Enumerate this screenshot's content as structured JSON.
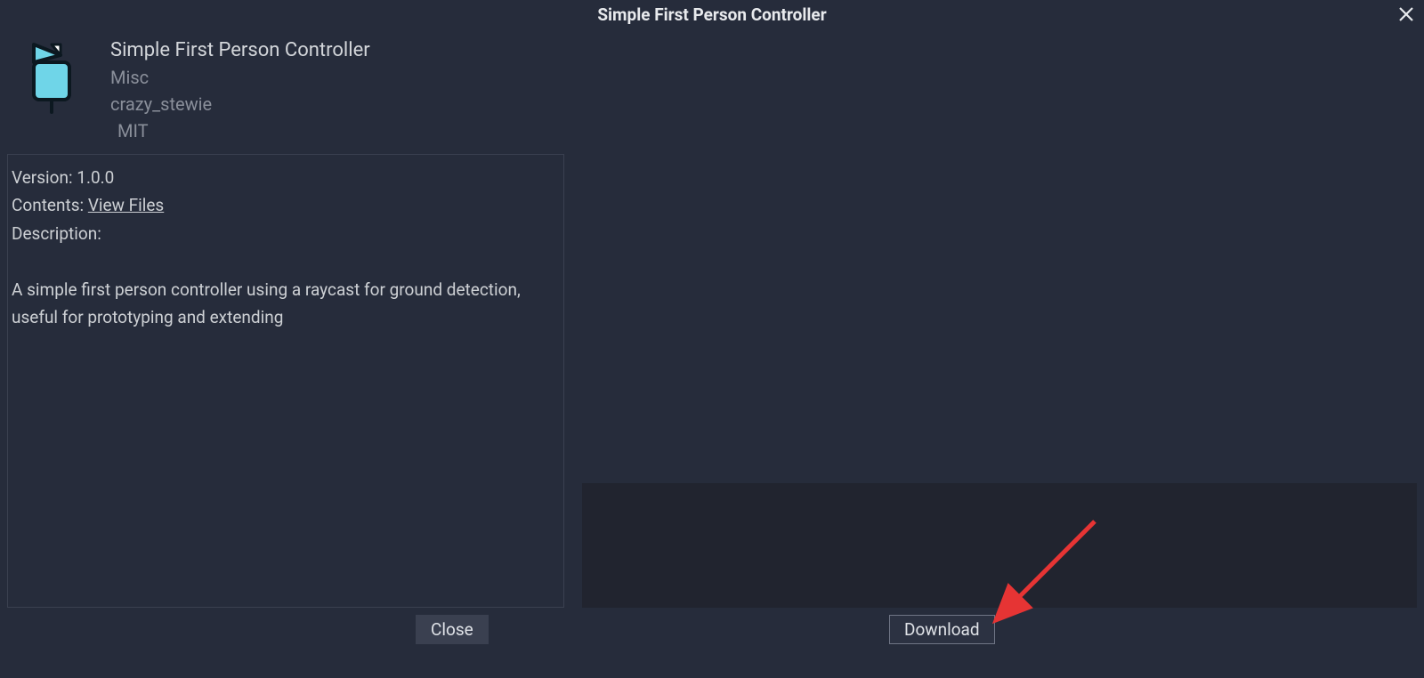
{
  "title": "Simple First Person Controller",
  "asset": {
    "name": "Simple First Person Controller",
    "category": "Misc",
    "author": "crazy_stewie",
    "license": "MIT"
  },
  "details": {
    "version_label": "Version:",
    "version_value": "1.0.0",
    "contents_label": "Contents:",
    "view_files_link": "View Files",
    "description_label": "Description:",
    "description_body": "A simple first person controller using a raycast for ground detection, useful for prototyping and extending"
  },
  "buttons": {
    "close": "Close",
    "download": "Download"
  }
}
